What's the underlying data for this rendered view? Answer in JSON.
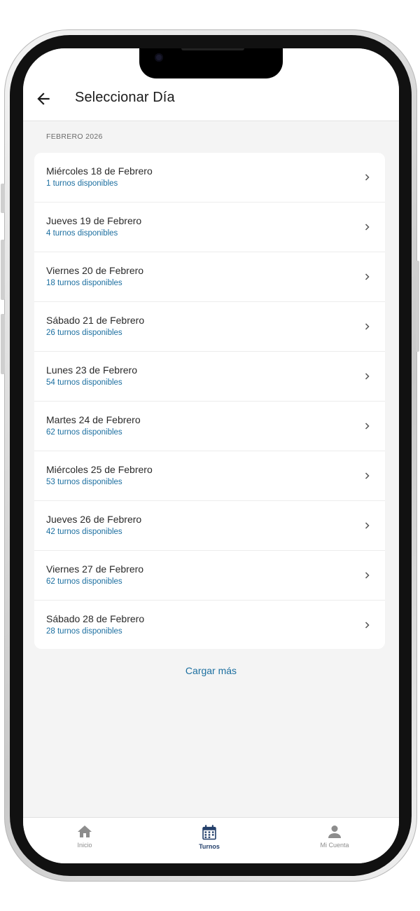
{
  "header": {
    "title": "Seleccionar Día",
    "back_icon": "arrow-left-icon"
  },
  "section": {
    "label": "FEBRERO 2026"
  },
  "days": [
    {
      "title": "Miércoles 18 de Febrero",
      "subtitle": "1 turnos disponibles"
    },
    {
      "title": "Jueves 19 de Febrero",
      "subtitle": "4 turnos disponibles"
    },
    {
      "title": "Viernes 20 de Febrero",
      "subtitle": "18 turnos disponibles"
    },
    {
      "title": "Sábado 21 de Febrero",
      "subtitle": "26 turnos disponibles"
    },
    {
      "title": "Lunes 23 de Febrero",
      "subtitle": "54 turnos disponibles"
    },
    {
      "title": "Martes 24 de Febrero",
      "subtitle": "62 turnos disponibles"
    },
    {
      "title": "Miércoles 25 de Febrero",
      "subtitle": "53 turnos disponibles"
    },
    {
      "title": "Jueves 26 de Febrero",
      "subtitle": "42 turnos disponibles"
    },
    {
      "title": "Viernes 27 de Febrero",
      "subtitle": "62 turnos disponibles"
    },
    {
      "title": "Sábado 28 de Febrero",
      "subtitle": "28 turnos disponibles"
    }
  ],
  "load_more_label": "Cargar más",
  "nav": {
    "items": [
      {
        "label": "Inicio",
        "icon": "home-icon",
        "active": false
      },
      {
        "label": "Turnos",
        "icon": "calendar-icon",
        "active": true
      },
      {
        "label": "Mi Cuenta",
        "icon": "person-icon",
        "active": false
      }
    ]
  },
  "colors": {
    "accent_link": "#1c6fa0",
    "active_nav": "#24406b",
    "inactive_nav": "#8d8d8d",
    "background": "#f4f4f4"
  }
}
